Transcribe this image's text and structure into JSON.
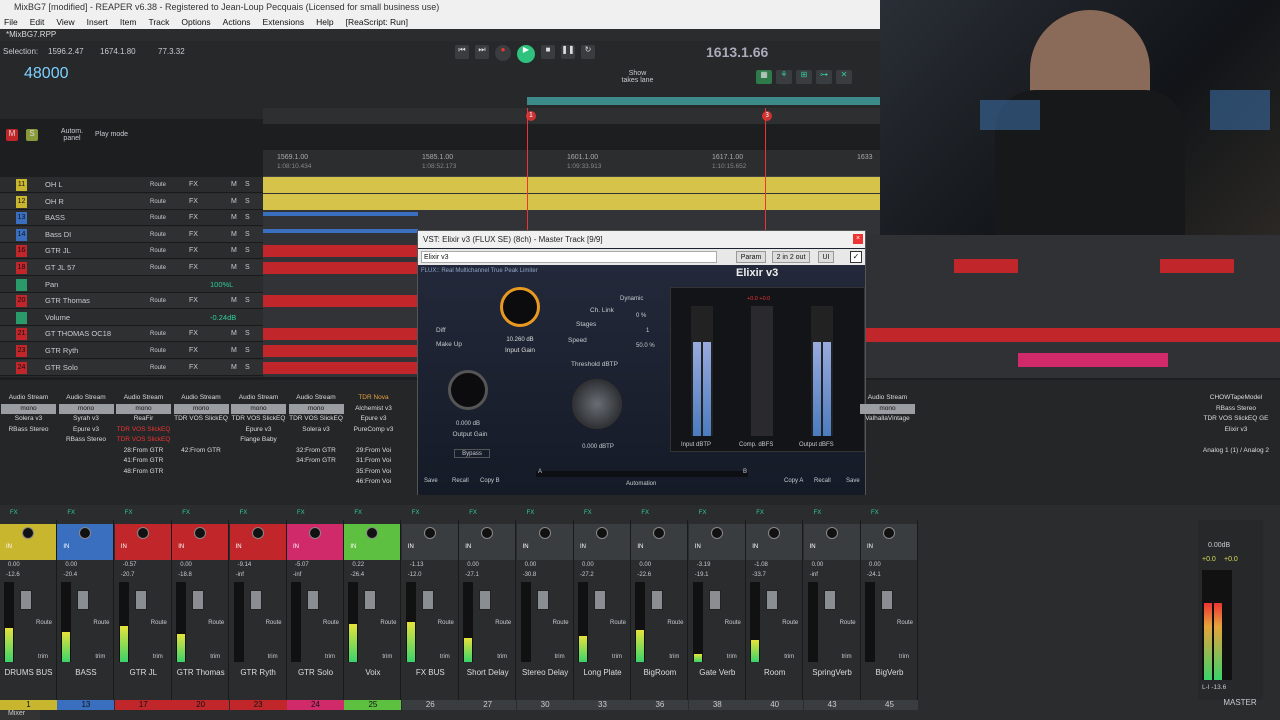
{
  "window": {
    "title": "MixBG7 [modified] - REAPER v6.38 - Registered to Jean-Loup Pecquais (Licensed for small business use)",
    "project_tab": "*MixBG7.RPP"
  },
  "menu": [
    "File",
    "Edit",
    "View",
    "Insert",
    "Item",
    "Track",
    "Options",
    "Actions",
    "Extensions",
    "Help",
    "[ReaScript: Run]"
  ],
  "transport": {
    "selection_label": "Selection:",
    "selection_start": "1596.2.47",
    "selection_end": "1674.1.80",
    "selection_len": "77.3.32",
    "samplerate": "48000",
    "position": "1613.1.66",
    "show_takes_lane": "Show takes lane",
    "autom_panel": "Autom. panel",
    "play_mode": "Play mode",
    "marker1": "1",
    "marker3": "3"
  },
  "ruler": [
    {
      "bar": "1569.1.00",
      "time": "1:08:10.434"
    },
    {
      "bar": "1585.1.00",
      "time": "1:08:52.173"
    },
    {
      "bar": "1601.1.00",
      "time": "1:09:33.913"
    },
    {
      "bar": "1617.1.00",
      "time": "1:10:15.652"
    },
    {
      "bar": "1633",
      "time": ""
    }
  ],
  "tracks": [
    {
      "num": "11",
      "name": "OH L",
      "color": "#c8b62e"
    },
    {
      "num": "12",
      "name": "OH R",
      "color": "#c8b62e"
    },
    {
      "num": "13",
      "name": "BASS",
      "color": "#3a6fc0"
    },
    {
      "num": "14",
      "name": "Bass DI",
      "color": "#3a6fc0"
    },
    {
      "num": "16",
      "name": "GTR JL",
      "color": "#c0262a"
    },
    {
      "num": "18",
      "name": "GT JL 57",
      "color": "#c0262a"
    },
    {
      "num": "",
      "name": "Pan",
      "color": "#2a9a6a",
      "env_value": "100%L"
    },
    {
      "num": "20",
      "name": "GTR Thomas",
      "color": "#c0262a"
    },
    {
      "num": "",
      "name": "Volume",
      "color": "#2a9a6a",
      "env_value": "-0.24dB"
    },
    {
      "num": "21",
      "name": "GT THOMAS OC18",
      "color": "#c0262a"
    },
    {
      "num": "23",
      "name": "GTR Ryth",
      "color": "#c0262a"
    },
    {
      "num": "24",
      "name": "GTR Solo",
      "color": "#c0262a"
    }
  ],
  "track_labels": {
    "route": "Route",
    "fx": "FX",
    "m": "M",
    "s": "S"
  },
  "plugin": {
    "title": "VST: Elixir v3 (FLUX SE) (8ch) - Master Track [9/9]",
    "preset": "Elixir v3",
    "param": "Param",
    "io": "2 in 2 out",
    "ui": "UI",
    "brand": "FLUX:: Real Multichannel True Peak Limiter",
    "product": "Elixir v3",
    "input_gain_value": "10.260 dB",
    "input_gain_label": "Input Gain",
    "output_gain_value": "0.000 dB",
    "output_gain_label": "Output Gain",
    "threshold_label": "Threshold dBTP",
    "threshold_value": "0.000 dBTP",
    "diff": "Diff",
    "makeup": "Make Up",
    "bypass": "Bypass",
    "ch_link": "Ch. Link",
    "ch_link_value": "0 %",
    "dynamic": "Dynamic",
    "stages": "Stages",
    "stages_value": "1",
    "speed": "Speed",
    "speed_value": "50.0 %",
    "input_meter": "Input dBTP",
    "comp_meter": "Comp. dBFS",
    "output_meter": "Output dBFS",
    "comp_peak": "+0.0 +0.0",
    "save": "Save",
    "recall": "Recall",
    "copy_b": "Copy B",
    "copy_a": "Copy A",
    "automation": "Automation",
    "a": "A",
    "b": "B",
    "input_gain_level": 0.78,
    "input_meter_level": 0.72,
    "output_meter_level": 0.72
  },
  "fx_columns": [
    [
      "Audio Stream",
      "mono",
      "Solera v3",
      "RBass Stereo"
    ],
    [
      "Audio Stream",
      "mono",
      "Syrah v3",
      "Epure v3",
      "RBass Stereo"
    ],
    [
      "Audio Stream",
      "mono",
      "ReaFir",
      "TDR VOS SlickEQ",
      "TDR VOS SlickEQ",
      "28:From GTR",
      "41:From GTR",
      "48:From GTR"
    ],
    [
      "Audio Stream",
      "mono",
      "TDR VOS SlickEQ",
      "",
      "",
      "42:From GTR"
    ],
    [
      "Audio Stream",
      "mono",
      "TDR VOS SlickEQ",
      "Epure v3",
      "Flange Baby"
    ],
    [
      "Audio Stream",
      "mono",
      "TDR VOS SlickEQ",
      "Solera v3",
      "",
      "32:From GTR",
      "34:From GTR"
    ],
    [
      "TDR Nova",
      "Alchemist v3",
      "Epure v3",
      "PureComp v3",
      "",
      "29:From Voi",
      "31:From Voi",
      "35:From Voi",
      "46:From Voi"
    ]
  ],
  "right_fx": [
    "Audio Stream",
    "mono",
    "ValhallaVintage"
  ],
  "master_fx": [
    "CHOWTapeModel",
    "RBass Stereo",
    "TDR VOS SlickEQ GE",
    "Elixir v3",
    "",
    "Analog 1 (1) / Analog 2"
  ],
  "channels": [
    {
      "name": "DRUMS BUS",
      "num": "1",
      "color": "#c8b62e",
      "vol": "0.00",
      "peak": "-12.6",
      "level": 0.42
    },
    {
      "name": "BASS",
      "num": "13",
      "color": "#3a6fc0",
      "vol": "0.00",
      "peak": "-20.4",
      "level": 0.38
    },
    {
      "name": "GTR JL",
      "num": "17",
      "color": "#c0262a",
      "vol": "-0.57",
      "peak": "-20.7",
      "level": 0.45
    },
    {
      "name": "GTR Thomas",
      "num": "20",
      "color": "#c0262a",
      "vol": "0.00",
      "peak": "-18.8",
      "level": 0.35
    },
    {
      "name": "GTR Ryth",
      "num": "23",
      "color": "#c0262a",
      "vol": "-9.14",
      "peak": "-inf",
      "level": 0.0
    },
    {
      "name": "GTR Solo",
      "num": "24",
      "color": "#d02a6a",
      "vol": "-5.07",
      "peak": "-inf",
      "level": 0.0
    },
    {
      "name": "Voix",
      "num": "25",
      "color": "#5ec040",
      "vol": "0.22",
      "peak": "-26.4",
      "level": 0.48
    },
    {
      "name": "FX BUS",
      "num": "26",
      "color": "#3a3d40",
      "vol": "-1.13",
      "peak": "-12.0",
      "level": 0.5
    },
    {
      "name": "Short Delay",
      "num": "27",
      "color": "#3a3d40",
      "vol": "0.00",
      "peak": "-27.1",
      "level": 0.3
    },
    {
      "name": "Stereo Delay",
      "num": "30",
      "color": "#3a3d40",
      "vol": "0.00",
      "peak": "-30.8",
      "level": 0.0
    },
    {
      "name": "Long Plate",
      "num": "33",
      "color": "#3a3d40",
      "vol": "0.00",
      "peak": "-27.2",
      "level": 0.32
    },
    {
      "name": "BigRoom",
      "num": "36",
      "color": "#3a3d40",
      "vol": "0.00",
      "peak": "-22.6",
      "level": 0.4
    },
    {
      "name": "Gate Verb",
      "num": "38",
      "color": "#3a3d40",
      "vol": "-3.19",
      "peak": "-19.1",
      "level": 0.1
    },
    {
      "name": "Room",
      "num": "40",
      "color": "#3a3d40",
      "vol": "-1.08",
      "peak": "-33.7",
      "level": 0.28
    },
    {
      "name": "SpringVerb",
      "num": "43",
      "color": "#3a3d40",
      "vol": "0.00",
      "peak": "-inf",
      "level": 0.0
    },
    {
      "name": "BigVerb",
      "num": "45",
      "color": "#3a3d40",
      "vol": "0.00",
      "peak": "-24.1",
      "level": 0.0
    }
  ],
  "mixer_labels": {
    "fx": "FX",
    "in": "IN",
    "route": "Route",
    "trim": "trim"
  },
  "master": {
    "name": "MASTER",
    "vol": "0.00dB",
    "peak_l": "+0.0",
    "peak_r": "+0.0",
    "lr": "L-I -13.6",
    "level": 0.7
  },
  "mixer_tab": "Mixer"
}
